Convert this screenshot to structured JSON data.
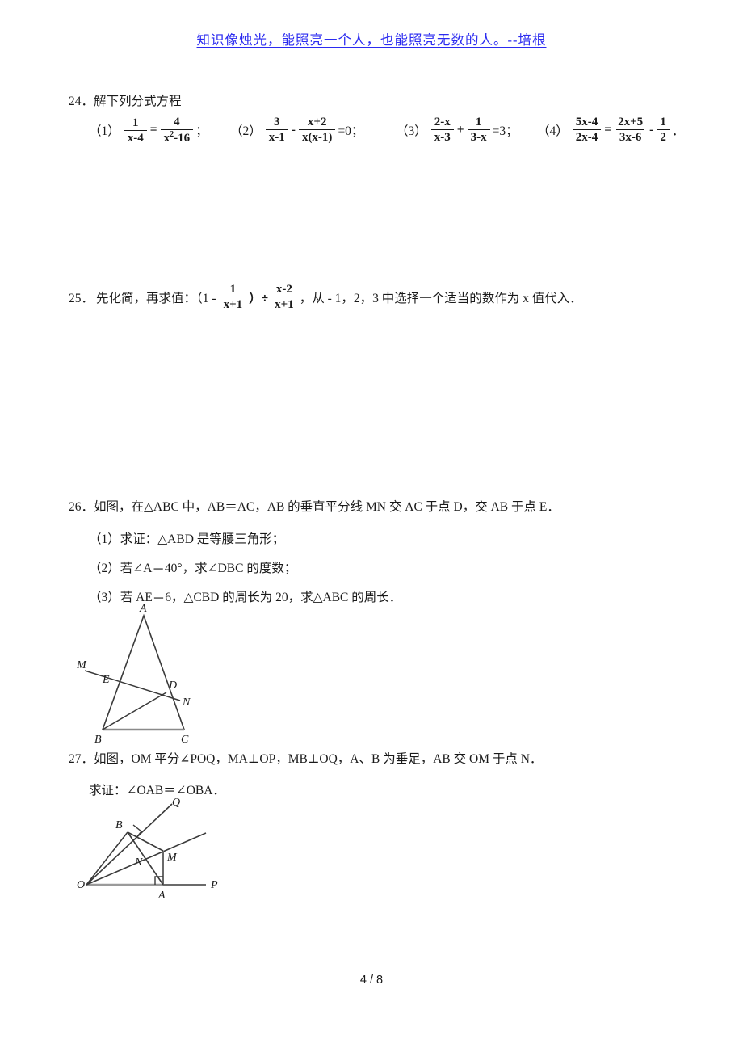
{
  "header": {
    "quote": "知识像烛光，能照亮一个人，也能照亮无数的人。--培根",
    "color": "#2b2bf0"
  },
  "problems": [
    {
      "number": "24．",
      "stem": "解下列分式方程",
      "parts": [
        {
          "label": "（1）",
          "num1": "1",
          "den1": "x-4",
          "op": "=",
          "num2": "4",
          "den2": "x  -16",
          "den2_base": "x",
          "den2_exp": "2",
          "den2_rest": "-16",
          "tail": "；"
        },
        {
          "label": "（2）",
          "num1": "3",
          "den1": "x-1",
          "op": "-",
          "num2": "x+2",
          "den2": "x(x-1)",
          "tail": "=0；"
        },
        {
          "label": "（3）",
          "num1": "2-x",
          "den1": "x-3",
          "op": "+",
          "num2": "1",
          "den2": "3-x",
          "tail": "=3；"
        },
        {
          "label": "（4）",
          "num1": "5x-4",
          "den1": "2x-4",
          "op": "=",
          "num2": "2x+5",
          "den2": "3x-6",
          "op2": "-",
          "num3": "1",
          "den3": "2",
          "tail": "．"
        }
      ]
    },
    {
      "number": "25．",
      "stem_before": "先化简，再求值：（1 -",
      "frac1_num": "1",
      "frac1_den": "x+1",
      "mid": "）÷",
      "frac2_num": "x-2",
      "frac2_den": "x+1",
      "stem_after": "，从 - 1，2，3 中选择一个适当的数作为 x 值代入．"
    },
    {
      "number": "26．",
      "stem": "如图，在△ABC 中，AB＝AC，AB 的垂直平分线 MN 交 AC 于点 D，交 AB 于点 E．",
      "items": [
        "（1）求证：△ABD 是等腰三角形；",
        "（2）若∠A＝40°，求∠DBC 的度数；",
        "（3）若 AE＝6，△CBD 的周长为 20，求△ABC 的周长．"
      ],
      "figure_labels": {
        "A": "A",
        "B": "B",
        "C": "C",
        "D": "D",
        "E": "E",
        "M": "M",
        "N": "N"
      }
    },
    {
      "number": "27．",
      "stem": "如图，OM 平分∠POQ，MA⊥OP，MB⊥OQ，A、B 为垂足，AB 交 OM 于点 N．",
      "items": [
        "求证：∠OAB＝∠OBA．"
      ],
      "figure_labels": {
        "O": "O",
        "P": "P",
        "Q": "Q",
        "A": "A",
        "B": "B",
        "M": "M",
        "N": "N"
      }
    }
  ],
  "footer": {
    "page": "4 / 8"
  }
}
